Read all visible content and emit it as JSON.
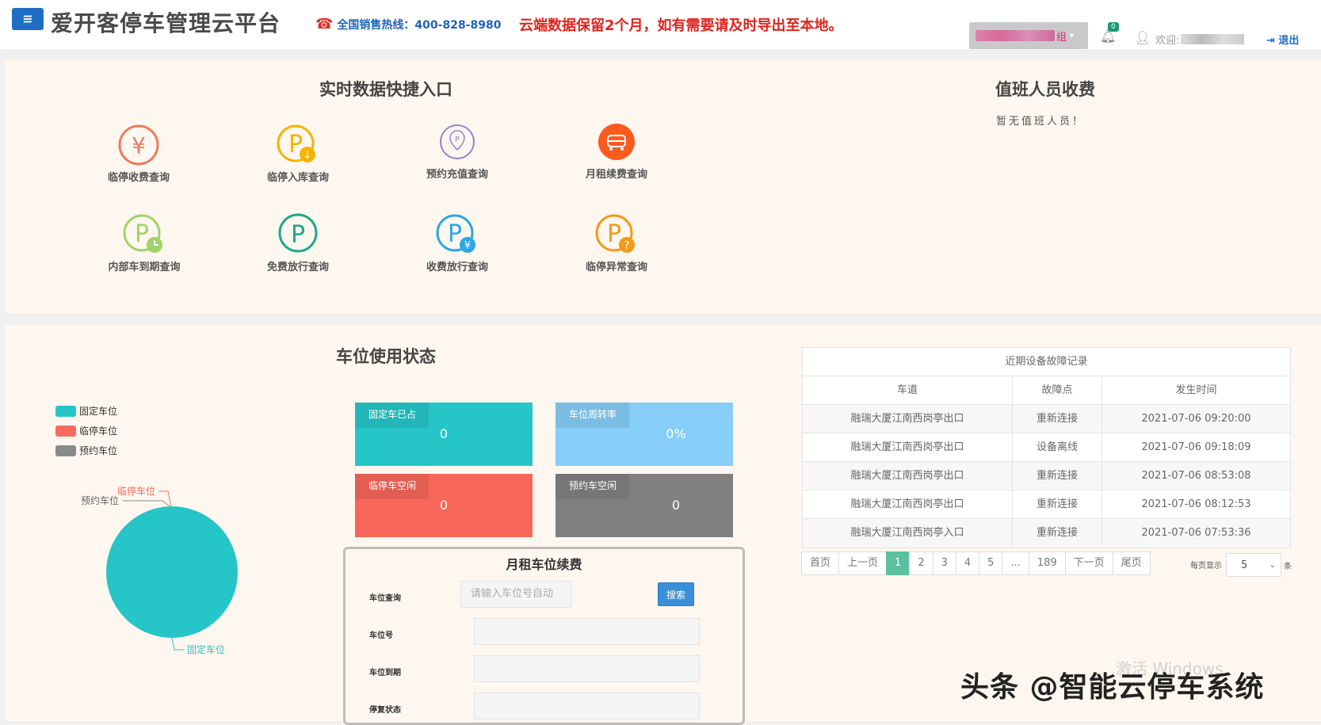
{
  "header": {
    "menu_icon": "≡",
    "title": "爱开客停车管理云平台",
    "hotline_icon": "phone-icon",
    "hotline": "全国销售热线：400-828-8980",
    "notice": "云端数据保留2个月，如有需要请及时导出至本地。",
    "group_suffix": "组",
    "bell_badge": "0",
    "welcome": "欢迎:",
    "logout": "退出"
  },
  "quick": {
    "title": "实时数据快捷入口",
    "items": [
      {
        "label": "临停收费查询",
        "icon": "yen-circle-icon",
        "color": "#f07a5a"
      },
      {
        "label": "临停入库查询",
        "icon": "parking-down-icon",
        "color": "#f5b400"
      },
      {
        "label": "预约充值查询",
        "icon": "parking-pin-icon",
        "color": "#9b7fd1"
      },
      {
        "label": "月租续费查询",
        "icon": "car-circle-icon",
        "color": "#fb5a1e"
      },
      {
        "label": "内部车到期查询",
        "icon": "parking-clock-icon",
        "color": "#9ed46a"
      },
      {
        "label": "免费放行查询",
        "icon": "parking-circle-icon",
        "color": "#1ea886"
      },
      {
        "label": "收费放行查询",
        "icon": "parking-yen-icon",
        "color": "#2ba7e6"
      },
      {
        "label": "临停异常查询",
        "icon": "parking-question-icon",
        "color": "#f39a19"
      }
    ]
  },
  "duty": {
    "title": "值班人员收费",
    "empty": "暂无值班人员！"
  },
  "status": {
    "title": "车位使用状态",
    "legend": [
      {
        "label": "固定车位",
        "color": "#25c5c8"
      },
      {
        "label": "临停车位",
        "color": "#f76b5e"
      },
      {
        "label": "预约车位",
        "color": "#8a8a8a"
      }
    ],
    "pie_labels": {
      "fixed": "固定车位",
      "temp": "临停车位",
      "reserve": "预约车位"
    },
    "tiles": [
      {
        "label": "固定车已占",
        "value": "0",
        "color": "#26c6c8"
      },
      {
        "label": "车位周转率",
        "value": "0%",
        "color": "#86cdf7"
      },
      {
        "label": "临停车空闲",
        "value": "0",
        "color": "#f6675a"
      },
      {
        "label": "预约车空闲",
        "value": "0",
        "color": "#808080"
      }
    ]
  },
  "renew": {
    "title": "月租车位续费",
    "search_label": "车位查询",
    "search_placeholder": "请输入车位号自动",
    "search_button": "搜索",
    "space_label": "车位号",
    "expire_label": "车位到期",
    "stop_label": "停复状态"
  },
  "faults": {
    "caption": "近期设备故障记录",
    "headers": [
      "车道",
      "故障点",
      "发生时间"
    ],
    "rows": [
      [
        "融瑞大厦江南西岗亭出口",
        "重新连接",
        "2021-07-06 09:20:00"
      ],
      [
        "融瑞大厦江南西岗亭出口",
        "设备离线",
        "2021-07-06 09:18:09"
      ],
      [
        "融瑞大厦江南西岗亭出口",
        "重新连接",
        "2021-07-06 08:53:08"
      ],
      [
        "融瑞大厦江南西岗亭出口",
        "重新连接",
        "2021-07-06 08:12:53"
      ],
      [
        "融瑞大厦江南西岗亭入口",
        "重新连接",
        "2021-07-06 07:53:36"
      ]
    ],
    "pager": [
      "首页",
      "上一页",
      "1",
      "2",
      "3",
      "4",
      "5",
      "...",
      "189",
      "下一页",
      "尾页"
    ],
    "active_page": "1",
    "per_page_label": "每页显示",
    "per_page_value": "5",
    "per_page_unit": "条"
  },
  "overlay": {
    "winact": "激活 Windows",
    "watermark": "头条 @智能云停车系统"
  }
}
